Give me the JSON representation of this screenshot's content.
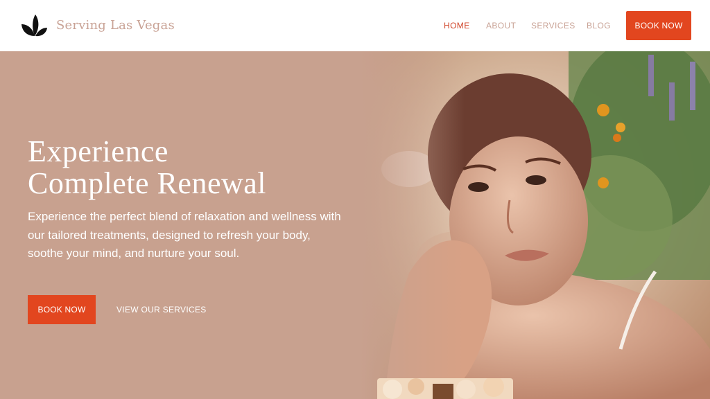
{
  "header": {
    "logo_icon": "butterfly-leaves-logo",
    "brand": "Serving Las Vegas",
    "nav": [
      "HOME",
      "ABOUT",
      "SERVICES",
      "BLOG"
    ],
    "active_nav": "HOME",
    "cta": "BOOK NOW"
  },
  "hero": {
    "title_line1": "Experience",
    "title_line2": "Complete Renewal",
    "text": "Experience the perfect blend of relaxation and wellness with our tailored treatments, designed to refresh your body, soothe your mind, and nurture your soul.",
    "book_label": "BOOK NOW",
    "services_label": "VIEW OUR SERVICES"
  },
  "colors": {
    "accent": "#e2461f",
    "hero_bg": "#c8a18f",
    "brand_text": "#c9a396",
    "active_nav": "#d0452a"
  }
}
